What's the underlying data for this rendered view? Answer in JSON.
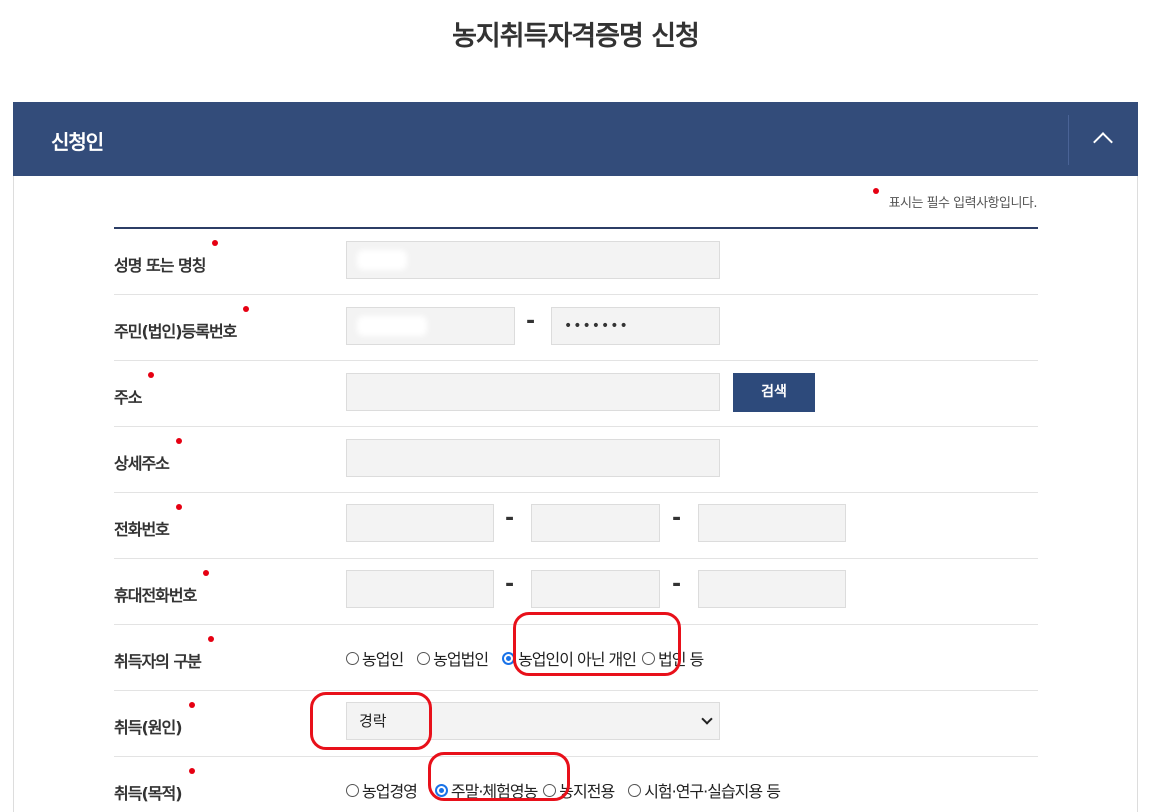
{
  "page": {
    "title": "농지취득자격증명 신청"
  },
  "panel": {
    "title": "신청인",
    "toggle_icon": "chevron-up-icon"
  },
  "required_note": "표시는 필수 입력사항입니다.",
  "form": {
    "name": {
      "label": "성명 또는 명칭"
    },
    "resident_number": {
      "label": "주민(법인)등록번호",
      "separator": "-",
      "back_value": "•••••••"
    },
    "address": {
      "label": "주소",
      "search_button": "검색"
    },
    "detail_address": {
      "label": "상세주소"
    },
    "phone": {
      "label": "전화번호",
      "separator": "-"
    },
    "mobile": {
      "label": "휴대전화번호",
      "separator": "-"
    },
    "acquirer_type": {
      "label": "취득자의 구분",
      "options": [
        "농업인",
        "농업법인",
        "농업인이 아닌 개인",
        "법인 등"
      ],
      "selected": "농업인이 아닌 개인"
    },
    "acquisition_cause": {
      "label": "취득(원인)",
      "selected": "경락"
    },
    "acquisition_purpose": {
      "label": "취득(목적)",
      "options": [
        "농업경영",
        "주말·체험영농",
        "농지전용",
        "시험·연구·실습지용 등"
      ],
      "selected": "주말·체험영농"
    }
  },
  "colors": {
    "header_bg": "#334c7a",
    "button_bg": "#2d4a7b",
    "required_dot": "#e60012",
    "annotation": "#e8101a",
    "radio_selected": "#1a73e8"
  }
}
